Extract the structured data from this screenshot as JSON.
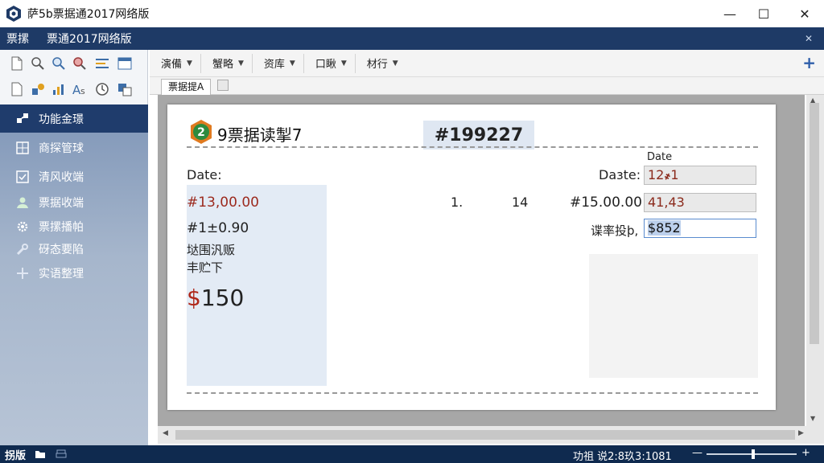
{
  "window": {
    "title": "萨5b票据通2017网络版",
    "min": "—",
    "max": "☐",
    "close": "✕"
  },
  "menubar": {
    "items": [
      "票摞",
      "票通2017网络版"
    ],
    "close_label": "✕"
  },
  "toolbar": {
    "dropdowns": [
      "演備",
      "蟹略",
      "资库",
      "口瞅",
      "材行"
    ],
    "add_label": "+"
  },
  "tabs": {
    "active": "票据提A"
  },
  "sidebar": {
    "items": [
      {
        "label": "功能金璟",
        "icon": "puzzle-icon",
        "active": true
      },
      {
        "label": "商探管球",
        "icon": "grid-icon"
      },
      {
        "label": "清风收端",
        "icon": "checkbox-icon"
      },
      {
        "label": "票据收端",
        "icon": "user-icon"
      },
      {
        "label": "票摞播帕",
        "icon": "gear-icon"
      },
      {
        "label": "砑态要陷",
        "icon": "wrench-icon"
      },
      {
        "label": "实语整理",
        "icon": "plus-icon"
      }
    ]
  },
  "ticket": {
    "logo_text": "2",
    "title": "9票据读掣7",
    "number": "#199227",
    "date_top_label": "Date",
    "date_left": "Date:",
    "amount1": "#13,00.00",
    "amount2": "#1±0.90",
    "line_cn1": "垯围汎贩",
    "line_cn2": "丰贮下",
    "big_currency": "$",
    "big_value": "150",
    "mid_num1": "1.",
    "mid_num2": "14",
    "mid_num3": "#15.00.00",
    "date_right_label": "Daзte:",
    "field1": "12҂1",
    "field2": "41,43",
    "field3_label": "谍率投þ,",
    "field3": "$852"
  },
  "statusbar": {
    "left": "拐版",
    "right": "功祖 说2:8玖3:1081",
    "zoom_minus": "—",
    "zoom_plus": "+"
  },
  "colors": {
    "menubar": "#1e3a66",
    "nav_active": "#1f3c6c",
    "statusbar": "#0f2a4f",
    "accent_red": "#b0281a"
  },
  "zoom": {
    "level": 0.5
  }
}
